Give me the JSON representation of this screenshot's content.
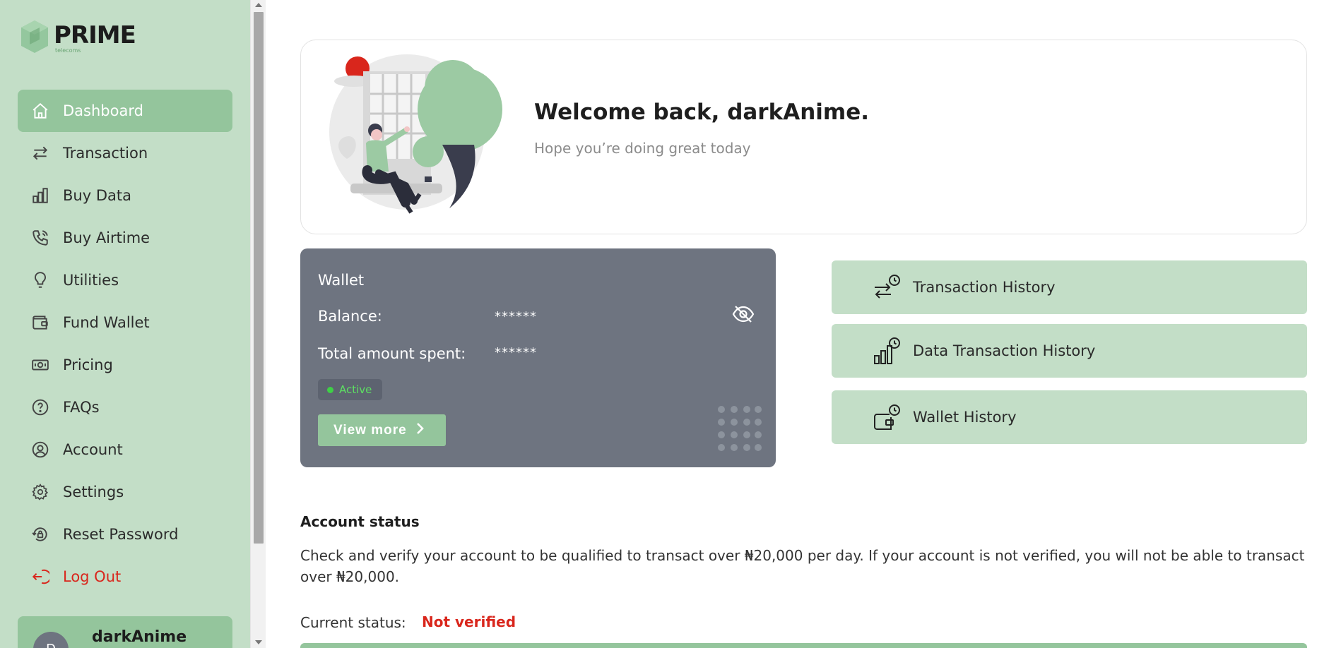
{
  "brand": {
    "name": "PRIME",
    "sub": "telecoms"
  },
  "sidebar": {
    "items": [
      {
        "label": "Dashboard",
        "icon": "home-icon",
        "active": true
      },
      {
        "label": "Transaction",
        "icon": "arrows-swap-icon"
      },
      {
        "label": "Buy Data",
        "icon": "bar-chart-icon"
      },
      {
        "label": "Buy Airtime",
        "icon": "phone-icon"
      },
      {
        "label": "Utilities",
        "icon": "lightbulb-icon"
      },
      {
        "label": "Fund Wallet",
        "icon": "wallet-icon"
      },
      {
        "label": "Pricing",
        "icon": "banknote-icon"
      },
      {
        "label": "FAQs",
        "icon": "question-circle-icon"
      },
      {
        "label": "Account",
        "icon": "user-circle-icon"
      },
      {
        "label": "Settings",
        "icon": "gear-icon"
      },
      {
        "label": "Reset Password",
        "icon": "lock-reset-icon"
      },
      {
        "label": "Log Out",
        "icon": "logout-icon"
      }
    ],
    "profile": {
      "initial": "D",
      "name": "darkAnime"
    }
  },
  "welcome": {
    "title": "Welcome back, darkAnime.",
    "subtitle": "Hope you’re doing great today"
  },
  "wallet": {
    "title": "Wallet",
    "balance_label": "Balance:",
    "balance_value": "******",
    "spent_label": "Total amount spent:",
    "spent_value": "******",
    "status": "Active",
    "view_more": "View more"
  },
  "history_buttons": [
    {
      "label": "Transaction History",
      "icon": "transaction-history-icon"
    },
    {
      "label": "Data Transaction History",
      "icon": "data-history-icon"
    },
    {
      "label": "Wallet History",
      "icon": "wallet-history-icon"
    }
  ],
  "account_status": {
    "title": "Account status",
    "description": "Check and verify your account to be qualified to transact over ₦20,000 per day. If your account is not verified, you will not be able to transact over ₦20,000.",
    "current_label": "Current status:",
    "current_value": "Not verified"
  },
  "colors": {
    "sidebar_bg": "#c3dec7",
    "accent": "#94c59c",
    "wallet_bg": "#6e7480",
    "danger": "#d9261c"
  }
}
